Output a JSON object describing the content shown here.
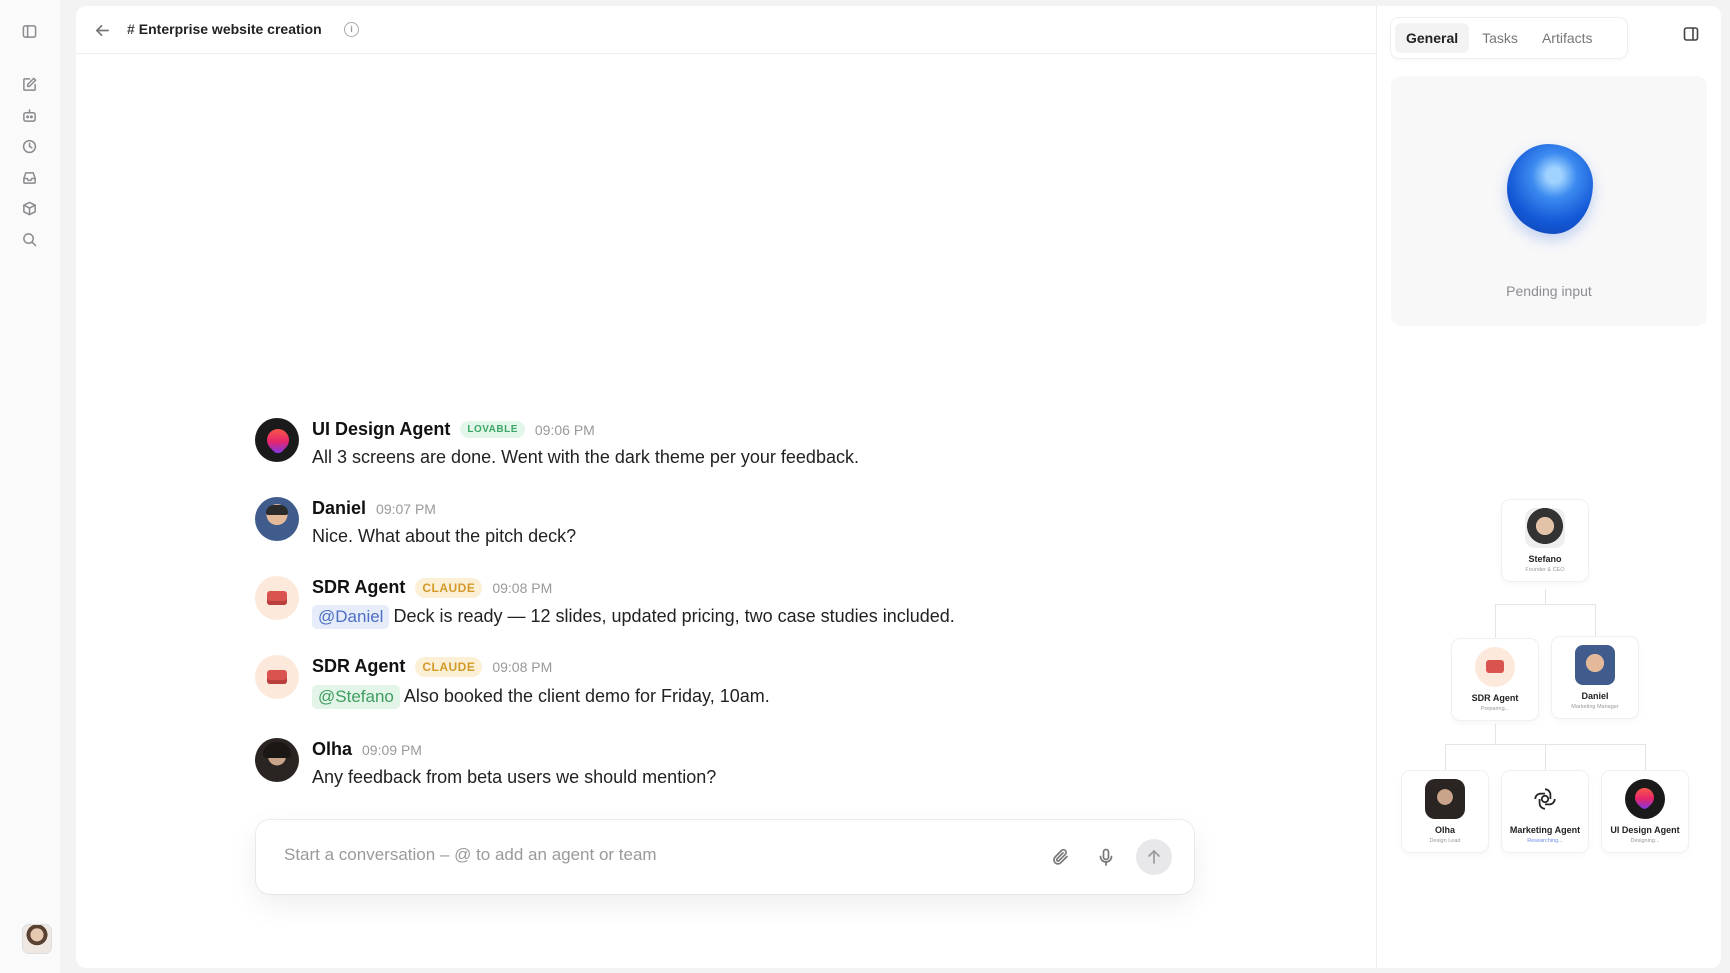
{
  "channel": {
    "title": "Enterprise website creation"
  },
  "messages": [
    {
      "author": "UI Design Agent",
      "tag": "LOVABLE",
      "time": "09:06 PM",
      "text": "All 3 screens are done. Went with the dark theme per your feedback."
    },
    {
      "author": "Daniel",
      "time": "09:07 PM",
      "text": "Nice. What about the pitch deck?"
    },
    {
      "author": "SDR Agent",
      "tag": "CLAUDE",
      "time": "09:08 PM",
      "mention": "@Daniel",
      "text": "Deck is ready — 12 slides, updated pricing, two case studies included."
    },
    {
      "author": "SDR Agent",
      "tag": "CLAUDE",
      "time": "09:08 PM",
      "mention": "@Stefano",
      "text": "Also booked the client demo for Friday, 10am."
    },
    {
      "author": "Olha",
      "time": "09:09 PM",
      "text": "Any feedback from beta users we should mention?"
    }
  ],
  "composer": {
    "placeholder": "Start a conversation – @ to add an agent or team"
  },
  "panel": {
    "tabs": [
      "General",
      "Tasks",
      "Artifacts"
    ],
    "active_tab": "General",
    "status": "Pending input"
  },
  "org": {
    "stefano": {
      "name": "Stefano",
      "role": "Founder & CEO"
    },
    "sdr": {
      "name": "SDR Agent",
      "role": "Preparing..."
    },
    "daniel": {
      "name": "Daniel",
      "role": "Marketing Manager"
    },
    "olha": {
      "name": "Olha",
      "role": "Design Lead"
    },
    "marketing": {
      "name": "Marketing Agent",
      "role": "Researching..."
    },
    "uidesign": {
      "name": "UI Design Agent",
      "role": "Designing..."
    }
  },
  "colors": {
    "accent": "#1458d6",
    "lovable": "#3aa765",
    "claude": "#d39a2a"
  }
}
